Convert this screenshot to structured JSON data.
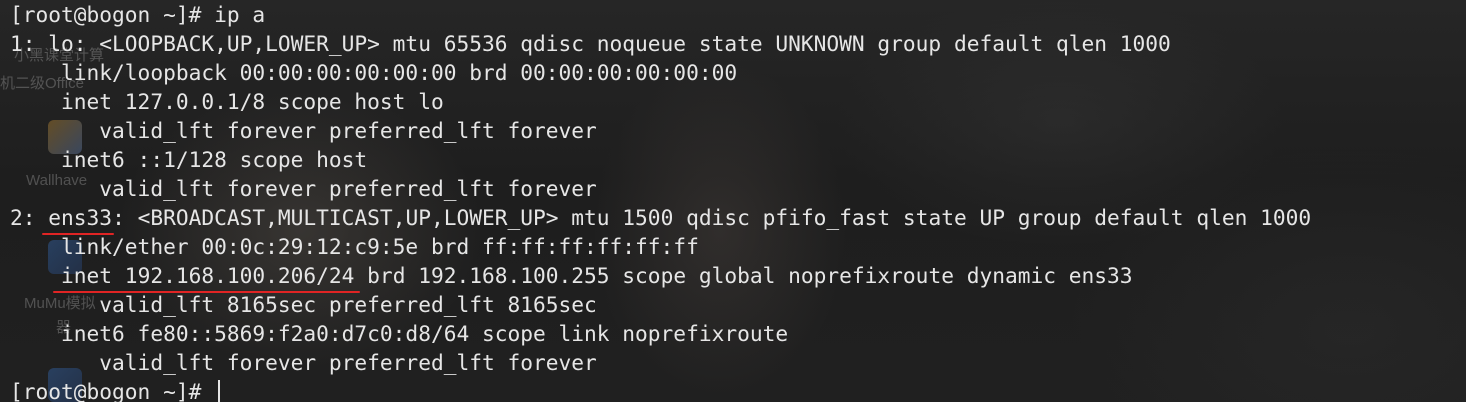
{
  "terminal": {
    "prompt": "[root@bogon ~]#",
    "command": "ip a",
    "lines": [
      "1: lo: <LOOPBACK,UP,LOWER_UP> mtu 65536 qdisc noqueue state UNKNOWN group default qlen 1000",
      "    link/loopback 00:00:00:00:00:00 brd 00:00:00:00:00:00",
      "    inet 127.0.0.1/8 scope host lo",
      "       valid_lft forever preferred_lft forever",
      "    inet6 ::1/128 scope host",
      "       valid_lft forever preferred_lft forever"
    ],
    "ens33": {
      "prefix": "2: ",
      "name": "ens33",
      "rest": ": <BROADCAST,MULTICAST,UP,LOWER_UP> mtu 1500 qdisc pfifo_fast state UP group default qlen 1000"
    },
    "link_ether": "    link/ether 00:0c:29:12:c9:5e brd ff:ff:ff:ff:ff:ff",
    "inet_line": {
      "indent": "    ",
      "address": "inet 192.168.100.206/24",
      "rest": " brd 192.168.100.255 scope global noprefixroute dynamic ens33"
    },
    "tail_lines": [
      "       valid_lft 8165sec preferred_lft 8165sec",
      "    inet6 fe80::5869:f2a0:d7c0:d8/64 scope link noprefixroute",
      "       valid_lft forever preferred_lft forever"
    ],
    "final_prompt": "[root@bogon ~]#"
  },
  "desktop_ghosts": {
    "labels": [
      "小黑课堂计算",
      "机二级Office",
      "Wallhave",
      "MuMu模拟",
      "器"
    ]
  },
  "colors": {
    "text": "#e6e6e6",
    "underline": "#e02424",
    "background": "#1f1f1f"
  }
}
